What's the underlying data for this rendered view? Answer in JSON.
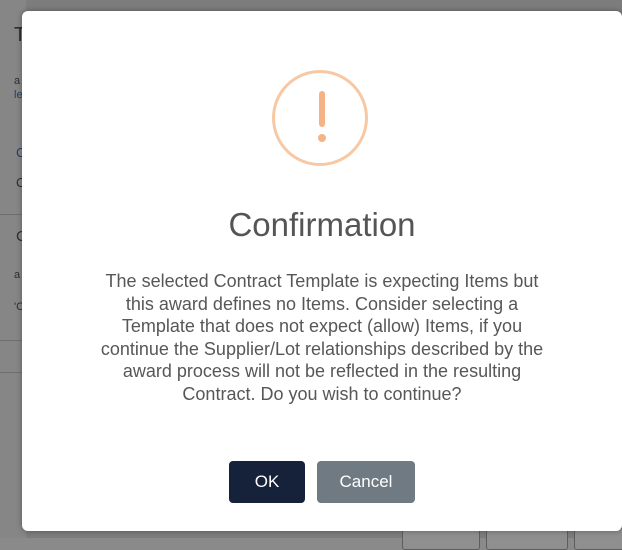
{
  "background": {
    "fragments": [
      "T",
      "a",
      "le",
      "C",
      "C",
      "C",
      "a",
      "'C"
    ]
  },
  "dialog": {
    "icon": "exclamation-warning-icon",
    "title": "Confirmation",
    "message_lines": [
      "The selected Contract Template is expecting Items but",
      "this award defines no Items. Consider selecting a",
      "Template that does not expect (allow) Items, if you",
      "continue the Supplier/Lot relationships described by the",
      "award process will not be reflected in the resulting",
      "Contract. Do you wish to continue?"
    ],
    "ok_label": "OK",
    "cancel_label": "Cancel"
  },
  "colors": {
    "ok_button": "#16213a",
    "cancel_button": "#6f7a83",
    "warning_icon": "#f5b285",
    "overlay": "#7d7d7d"
  }
}
